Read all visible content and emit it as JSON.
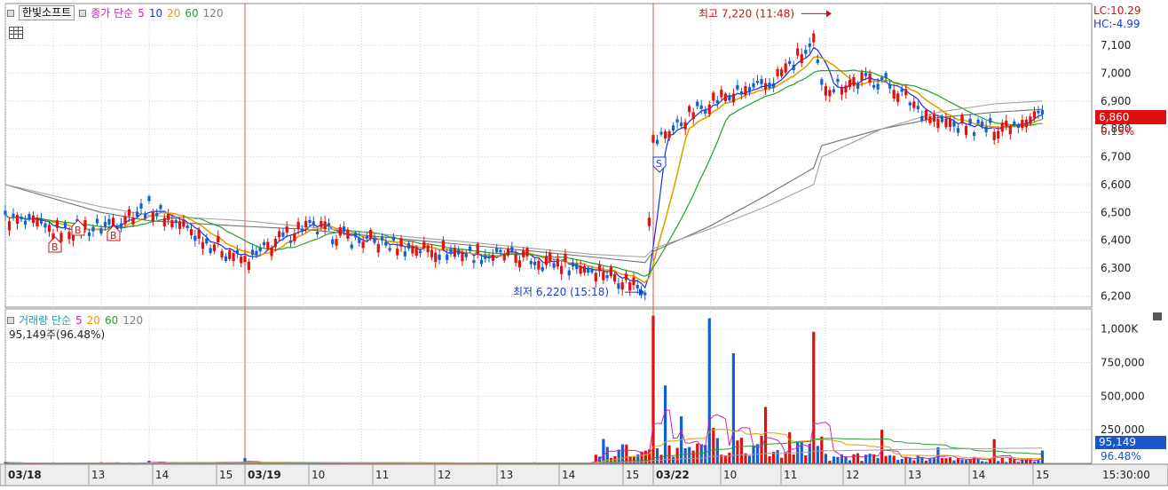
{
  "price_panel": {
    "stock_name": "한빛소프트",
    "legend_label": "종가 단순",
    "ma": [
      "5",
      "10",
      "20",
      "60",
      "120"
    ],
    "lc": "LC:10.29",
    "hc": "HC:-4.99",
    "current_price": "6,860",
    "current_change": "0.15%",
    "high_label": "최고 7,220 (11:48)",
    "low_label": "최저 6,220 (15:18)",
    "marker_b": "B",
    "marker_s": "S"
  },
  "volume_panel": {
    "legend_label": "거래량 단순",
    "ma": [
      "5",
      "20",
      "60",
      "120"
    ],
    "info": "95,149주(96.48%)",
    "current_volume": "95,149",
    "current_pct": "96.48%"
  },
  "time_axis": {
    "labels": [
      "03/18",
      "13",
      "14",
      "15",
      "03/19",
      "10",
      "11",
      "12",
      "13",
      "14",
      "15",
      "03/22",
      "10",
      "11",
      "12",
      "13",
      "14",
      "15"
    ],
    "clock": "15:30:00"
  },
  "colors": {
    "up": "#e01010",
    "down": "#1060d0",
    "ma5": "#1a2ee0",
    "ma10": "#e0a000",
    "ma20": "#20a030",
    "ma60": "#707070",
    "ma120": "#a0a0a0",
    "session_line": "#e05050"
  },
  "chart_data": [
    {
      "type": "candlestick",
      "title": "한빛소프트",
      "y_ticks": [
        6200,
        6300,
        6400,
        6500,
        6600,
        6700,
        6800,
        6900,
        7000,
        7100
      ],
      "y_tick_labels": [
        "6,200",
        "6,300",
        "6,400",
        "6,500",
        "6,600",
        "6,700",
        "6,800",
        "6,900",
        "7,000",
        "7,100"
      ],
      "ylim": [
        6160,
        7250
      ],
      "x": [
        "03/18 12:00",
        "03/18 13:00",
        "03/18 14:00",
        "03/18 15:00",
        "03/19 09:00",
        "03/19 10:00",
        "03/19 11:00",
        "03/19 12:00",
        "03/19 13:00",
        "03/19 14:00",
        "03/19 15:00",
        "03/19 15:18",
        "03/22 09:00",
        "03/22 10:00",
        "03/22 11:00",
        "03/22 11:48",
        "03/22 12:00",
        "03/22 13:00",
        "03/22 14:00",
        "03/22 15:00",
        "03/22 15:30"
      ],
      "close": [
        6480,
        6430,
        6450,
        6520,
        6320,
        6450,
        6400,
        6370,
        6350,
        6330,
        6300,
        6230,
        6750,
        6900,
        6950,
        7100,
        6950,
        6980,
        6820,
        6800,
        6860
      ],
      "high_marker": {
        "value": 7220,
        "time": "11:48"
      },
      "low_marker": {
        "value": 6220,
        "time": "15:18"
      },
      "ma60": [
        6600,
        6550,
        6500,
        6470,
        6450,
        6440,
        6420,
        6400,
        6380,
        6360,
        6340,
        6320,
        6360,
        6450,
        6560,
        6660,
        6740,
        6800,
        6840,
        6860,
        6870
      ],
      "ma120": [
        6600,
        6560,
        6520,
        6490,
        6470,
        6450,
        6430,
        6410,
        6390,
        6370,
        6350,
        6340,
        6370,
        6440,
        6520,
        6600,
        6700,
        6800,
        6860,
        6890,
        6900
      ]
    },
    {
      "type": "bar",
      "title": "거래량",
      "y_ticks": [
        250000,
        500000,
        750000,
        1000000
      ],
      "y_tick_labels": [
        "250,000",
        "500,000",
        "750,000",
        "1,000K"
      ],
      "ylim": [
        0,
        1150000
      ],
      "x": [
        "03/18 12:00",
        "03/18 13:00",
        "03/18 14:00",
        "03/18 15:00",
        "03/19 09:00",
        "03/19 10:00",
        "03/19 11:00",
        "03/19 12:00",
        "03/19 13:00",
        "03/19 14:00",
        "03/19 15:00",
        "03/22 09:00",
        "03/22 09:10",
        "03/22 09:20",
        "03/22 10:00",
        "03/22 10:30",
        "03/22 11:00",
        "03/22 11:48",
        "03/22 12:00",
        "03/22 13:00",
        "03/22 14:00",
        "03/22 15:00",
        "03/22 15:30"
      ],
      "values": [
        10000,
        8000,
        9000,
        20000,
        40000,
        10000,
        8000,
        7000,
        7000,
        8000,
        10000,
        1100000,
        580000,
        350000,
        1080000,
        820000,
        420000,
        980000,
        200000,
        250000,
        120000,
        180000,
        95149
      ],
      "current": 95149
    }
  ]
}
